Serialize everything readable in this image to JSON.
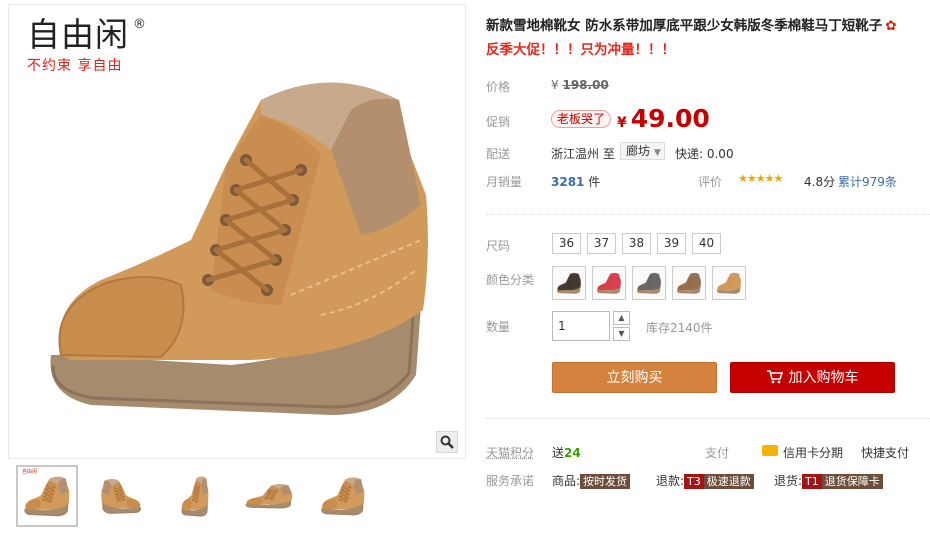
{
  "brand": {
    "name": "自由闲",
    "reg": "®",
    "slogan": "不约束 享自由",
    "thumb_logo": "自由闲"
  },
  "product": {
    "title": "新款雪地棉靴女 防水系带加厚底平跟少女韩版冬季棉鞋马丁短靴子",
    "title_icon": "✿",
    "promo": "反季大促！！！只为冲量！！！"
  },
  "price": {
    "label": "价格",
    "currency": "¥",
    "original": "198.00",
    "promo_label": "促销",
    "promo_tag": "老板哭了",
    "current": "49.00"
  },
  "shipping": {
    "label": "配送",
    "from": "浙江温州",
    "to": "至",
    "city": "廊坊",
    "fee": "快递: 0.00"
  },
  "sales": {
    "label": "月销量",
    "count": "3281",
    "unit": "件",
    "review_label": "评价",
    "stars": "★★★★★",
    "score": "4.8分",
    "review_count": "累计979条"
  },
  "size": {
    "label": "尺码",
    "options": [
      "36",
      "37",
      "38",
      "39",
      "40"
    ]
  },
  "color": {
    "label": "颜色分类",
    "swatches": [
      "#2a2a2a",
      "#d8334a",
      "#5b5f66",
      "#8a6a50",
      "#d59a5c"
    ]
  },
  "quantity": {
    "label": "数量",
    "value": "1",
    "up": "▲",
    "down": "▼",
    "stock": "库存2140件"
  },
  "actions": {
    "buy": "立刻购买",
    "cart": "加入购物车"
  },
  "points": {
    "label": "天猫积分",
    "prefix": "送",
    "value": "24"
  },
  "payment": {
    "label": "支付",
    "card": "信用卡分期",
    "quick": "快捷支付"
  },
  "services": {
    "label": "服务承诺",
    "items": [
      {
        "name": "商品:",
        "badge": "按时发货"
      },
      {
        "name": "退款:",
        "code": "T3",
        "badge": "极速退款"
      },
      {
        "name": "退货:",
        "code": "T1",
        "badge": "退货保障卡"
      }
    ]
  },
  "colors": {
    "price_red": "#c40000",
    "buy_orange": "#d5823e",
    "cart_red": "#c40000",
    "link_blue": "#3a6ea8",
    "star_gold": "#f5a300"
  }
}
